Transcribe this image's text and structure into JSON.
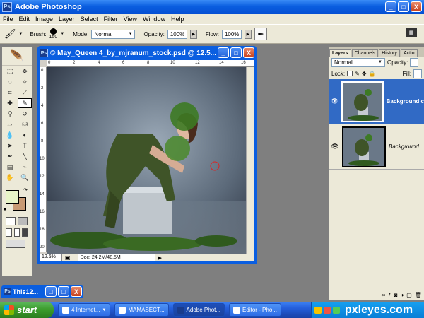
{
  "app": {
    "title": "Adobe Photoshop",
    "icon_label": "Ps"
  },
  "window_controls": {
    "minimize": "_",
    "maximize": "□",
    "close": "X"
  },
  "menu": [
    "File",
    "Edit",
    "Image",
    "Layer",
    "Select",
    "Filter",
    "View",
    "Window",
    "Help"
  ],
  "options_bar": {
    "brush_label": "Brush:",
    "brush_size": "150",
    "mode_label": "Mode:",
    "mode_value": "Normal",
    "opacity_label": "Opacity:",
    "opacity_value": "100%",
    "flow_label": "Flow:",
    "flow_value": "100%"
  },
  "document": {
    "title": "© May_Queen 4_by_mjranum_stock.psd @ 12.5...",
    "zoom": "12.5%",
    "doc_info": "Doc: 24.2M/48.5M",
    "ruler_top": [
      "0",
      "2",
      "4",
      "6",
      "8",
      "10",
      "12",
      "14",
      "16"
    ],
    "ruler_left": [
      "0",
      "2",
      "4",
      "6",
      "8",
      "10",
      "12",
      "14",
      "16",
      "18",
      "20"
    ]
  },
  "layers_panel": {
    "tabs": [
      "Layers",
      "Channels",
      "History",
      "Actio"
    ],
    "blend_mode": "Normal",
    "opacity_label": "Opacity:",
    "lock_label": "Lock:",
    "fill_label": "Fill:",
    "layers": [
      {
        "name": "Background c",
        "selected": true
      },
      {
        "name": "Background",
        "selected": false
      }
    ]
  },
  "minimized_window": {
    "title": "This12..."
  },
  "taskbar": {
    "start_label": "start",
    "items": [
      {
        "label": "4 Internet...",
        "active": false
      },
      {
        "label": "MAMASECT...",
        "active": false
      },
      {
        "label": "Adobe Phot...",
        "active": true
      },
      {
        "label": "Editor - Pho...",
        "active": false
      }
    ],
    "watermark": "pxleyes.com"
  },
  "colors": {
    "foreground": "#e8f5c8",
    "background": "#c89a74",
    "xp_blue": "#0a5ee0"
  }
}
